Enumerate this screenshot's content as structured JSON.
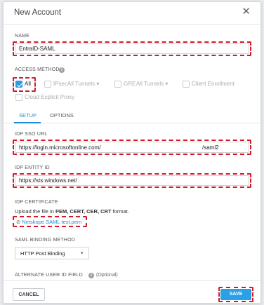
{
  "header": {
    "title": "New Account"
  },
  "name": {
    "label": "NAME",
    "value": "EntraID-SAML"
  },
  "access_method": {
    "label": "ACCESS METHOD",
    "all": "All",
    "ipsec": "IPsec",
    "ipsec_tunnels": "All Tunnels",
    "gre": "GRE",
    "gre_tunnels": "All Tunnels",
    "client_enrollment": "Client Enrollment",
    "cloud_explicit_proxy": "Cloud Explicit Proxy"
  },
  "tabs": [
    {
      "label": "SETUP",
      "active": true
    },
    {
      "label": "OPTIONS",
      "active": false
    }
  ],
  "idp_sso_url": {
    "label": "IDP SSO URL",
    "value_start": "https://login.microsoftonline.com/",
    "value_end": "/saml2"
  },
  "idp_entity_id": {
    "label": "IDP ENTITY ID",
    "value": "https://sts.windows.net/"
  },
  "idp_certificate": {
    "label": "IDP CERTIFICATE",
    "instructions_prefix": "Upload the file in ",
    "instructions_formats": "PEM, CERT, CER, CRT",
    "instructions_suffix": " format.",
    "file_name": "Netskope SAML test.pem"
  },
  "saml_binding": {
    "label": "SAML BINDING METHOD",
    "value": "HTTP Post Binding"
  },
  "alternate_user_id": {
    "label": "ALTERNATE USER ID FIELD",
    "optional": "(Optional)"
  },
  "footer": {
    "cancel": "CANCEL",
    "save": "SAVE"
  },
  "colors": {
    "accent": "#1f8ad6",
    "save_bg": "#2aa0e6",
    "highlight": "#d11a2a"
  }
}
